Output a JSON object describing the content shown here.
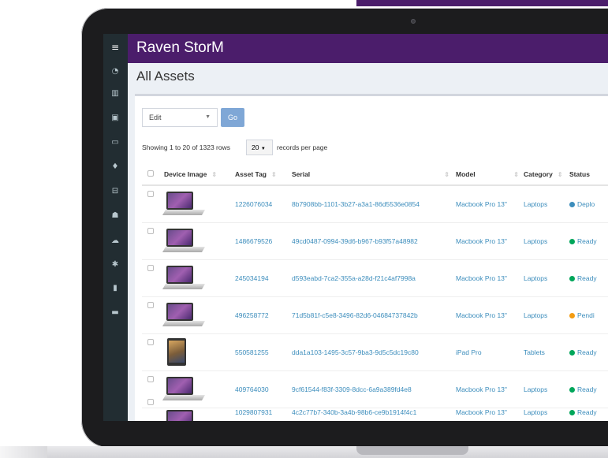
{
  "app": {
    "brand": "Raven StorM"
  },
  "page": {
    "title": "All Assets"
  },
  "toolbar": {
    "bulk_action": "Edit",
    "go_label": "Go"
  },
  "pagination": {
    "showing_text": "Showing 1 to 20 of 1323 rows",
    "per_page": "20",
    "per_page_suffix": "records per page"
  },
  "table": {
    "headers": {
      "device_image": "Device Image",
      "asset_tag": "Asset Tag",
      "serial": "Serial",
      "model": "Model",
      "category": "Category",
      "status": "Status"
    },
    "rows": [
      {
        "image": "laptop",
        "asset_tag": "1226076034",
        "serial": "8b7908bb-1101-3b27-a3a1-86d5536e0854",
        "model": "Macbook Pro 13\"",
        "category": "Laptops",
        "status": "Deplo",
        "status_color": "#3c8dbc"
      },
      {
        "image": "laptop",
        "asset_tag": "1486679526",
        "serial": "49cd0487-0994-39d6-b967-b93f57a48982",
        "model": "Macbook Pro 13\"",
        "category": "Laptops",
        "status": "Ready",
        "status_color": "#00a65a"
      },
      {
        "image": "laptop",
        "asset_tag": "245034194",
        "serial": "d593eabd-7ca2-355a-a28d-f21c4af7998a",
        "model": "Macbook Pro 13\"",
        "category": "Laptops",
        "status": "Ready",
        "status_color": "#00a65a"
      },
      {
        "image": "laptop",
        "asset_tag": "496258772",
        "serial": "71d5b81f-c5e8-3496-82d6-04684737842b",
        "model": "Macbook Pro 13\"",
        "category": "Laptops",
        "status": "Pendi",
        "status_color": "#f39c12"
      },
      {
        "image": "ipad",
        "asset_tag": "550581255",
        "serial": "dda1a103-1495-3c57-9ba3-9d5c5dc19c80",
        "model": "iPad Pro",
        "category": "Tablets",
        "status": "Ready",
        "status_color": "#00a65a"
      },
      {
        "image": "laptop",
        "asset_tag": "409764030",
        "serial": "9cf61544-f83f-3309-8dcc-6a9a389fd4e8",
        "model": "Macbook Pro 13\"",
        "category": "Laptops",
        "status": "Ready",
        "status_color": "#00a65a"
      },
      {
        "image": "laptop",
        "asset_tag": "1029807931",
        "serial": "4c2c77b7-340b-3a4b-98b6-ce9b1914f4c1",
        "model": "Macbook Pro 13\"",
        "category": "Laptops",
        "status": "Ready",
        "status_color": "#00a65a"
      }
    ]
  },
  "sidebar": {
    "icons": [
      "menu-icon",
      "dashboard-icon",
      "barcode-icon",
      "license-icon",
      "keyboard-icon",
      "consumable-icon",
      "component-icon",
      "users-icon",
      "cloud-icon",
      "settings-icon",
      "reports-icon",
      "laptop-icon"
    ]
  },
  "colors": {
    "brand": "#4b1d6b",
    "sidebar": "#222d32",
    "link": "#3c8dbc"
  }
}
